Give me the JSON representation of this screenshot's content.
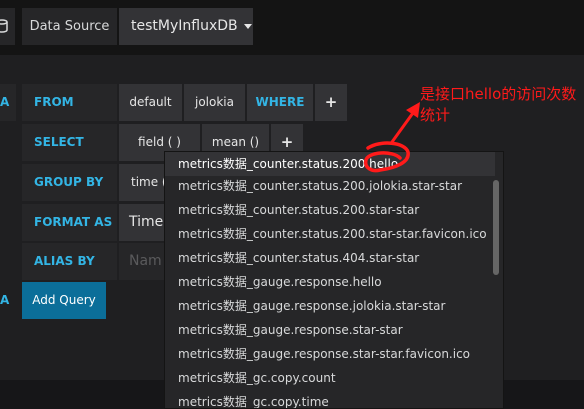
{
  "topbar": {
    "icon": "database-icon",
    "datasource_label": "Data Source",
    "datasource_value": "testMyInfluxDB"
  },
  "query": {
    "partial_letter": "A",
    "from": {
      "keyword": "FROM",
      "policy": "default",
      "measurement": "jolokia",
      "where": "WHERE",
      "add": "+"
    },
    "select": {
      "keyword": "SELECT",
      "field": "field (    )",
      "func": "mean ()",
      "add": "+"
    },
    "group_by": {
      "keyword": "GROUP BY",
      "value": "time ("
    },
    "format_as": {
      "keyword": "FORMAT AS",
      "value": "Time"
    },
    "alias_by": {
      "keyword": "ALIAS BY",
      "placeholder": "Nam"
    },
    "add_query_label": "Add Query"
  },
  "dropdown": {
    "items": [
      "metrics数据_counter.status.200.hello",
      "metrics数据_counter.status.200.jolokia.star-star",
      "metrics数据_counter.status.200.star-star",
      "metrics数据_counter.status.200.star-star.favicon.ico",
      "metrics数据_counter.status.404.star-star",
      "metrics数据_gauge.response.hello",
      "metrics数据_gauge.response.jolokia.star-star",
      "metrics数据_gauge.response.star-star",
      "metrics数据_gauge.response.star-star.favicon.ico",
      "metrics数据_gc.copy.count",
      "metrics数据_gc.copy.time"
    ]
  },
  "annotation": {
    "text": "是接口hello的访问次数统计",
    "color": "#ff1a1a"
  }
}
